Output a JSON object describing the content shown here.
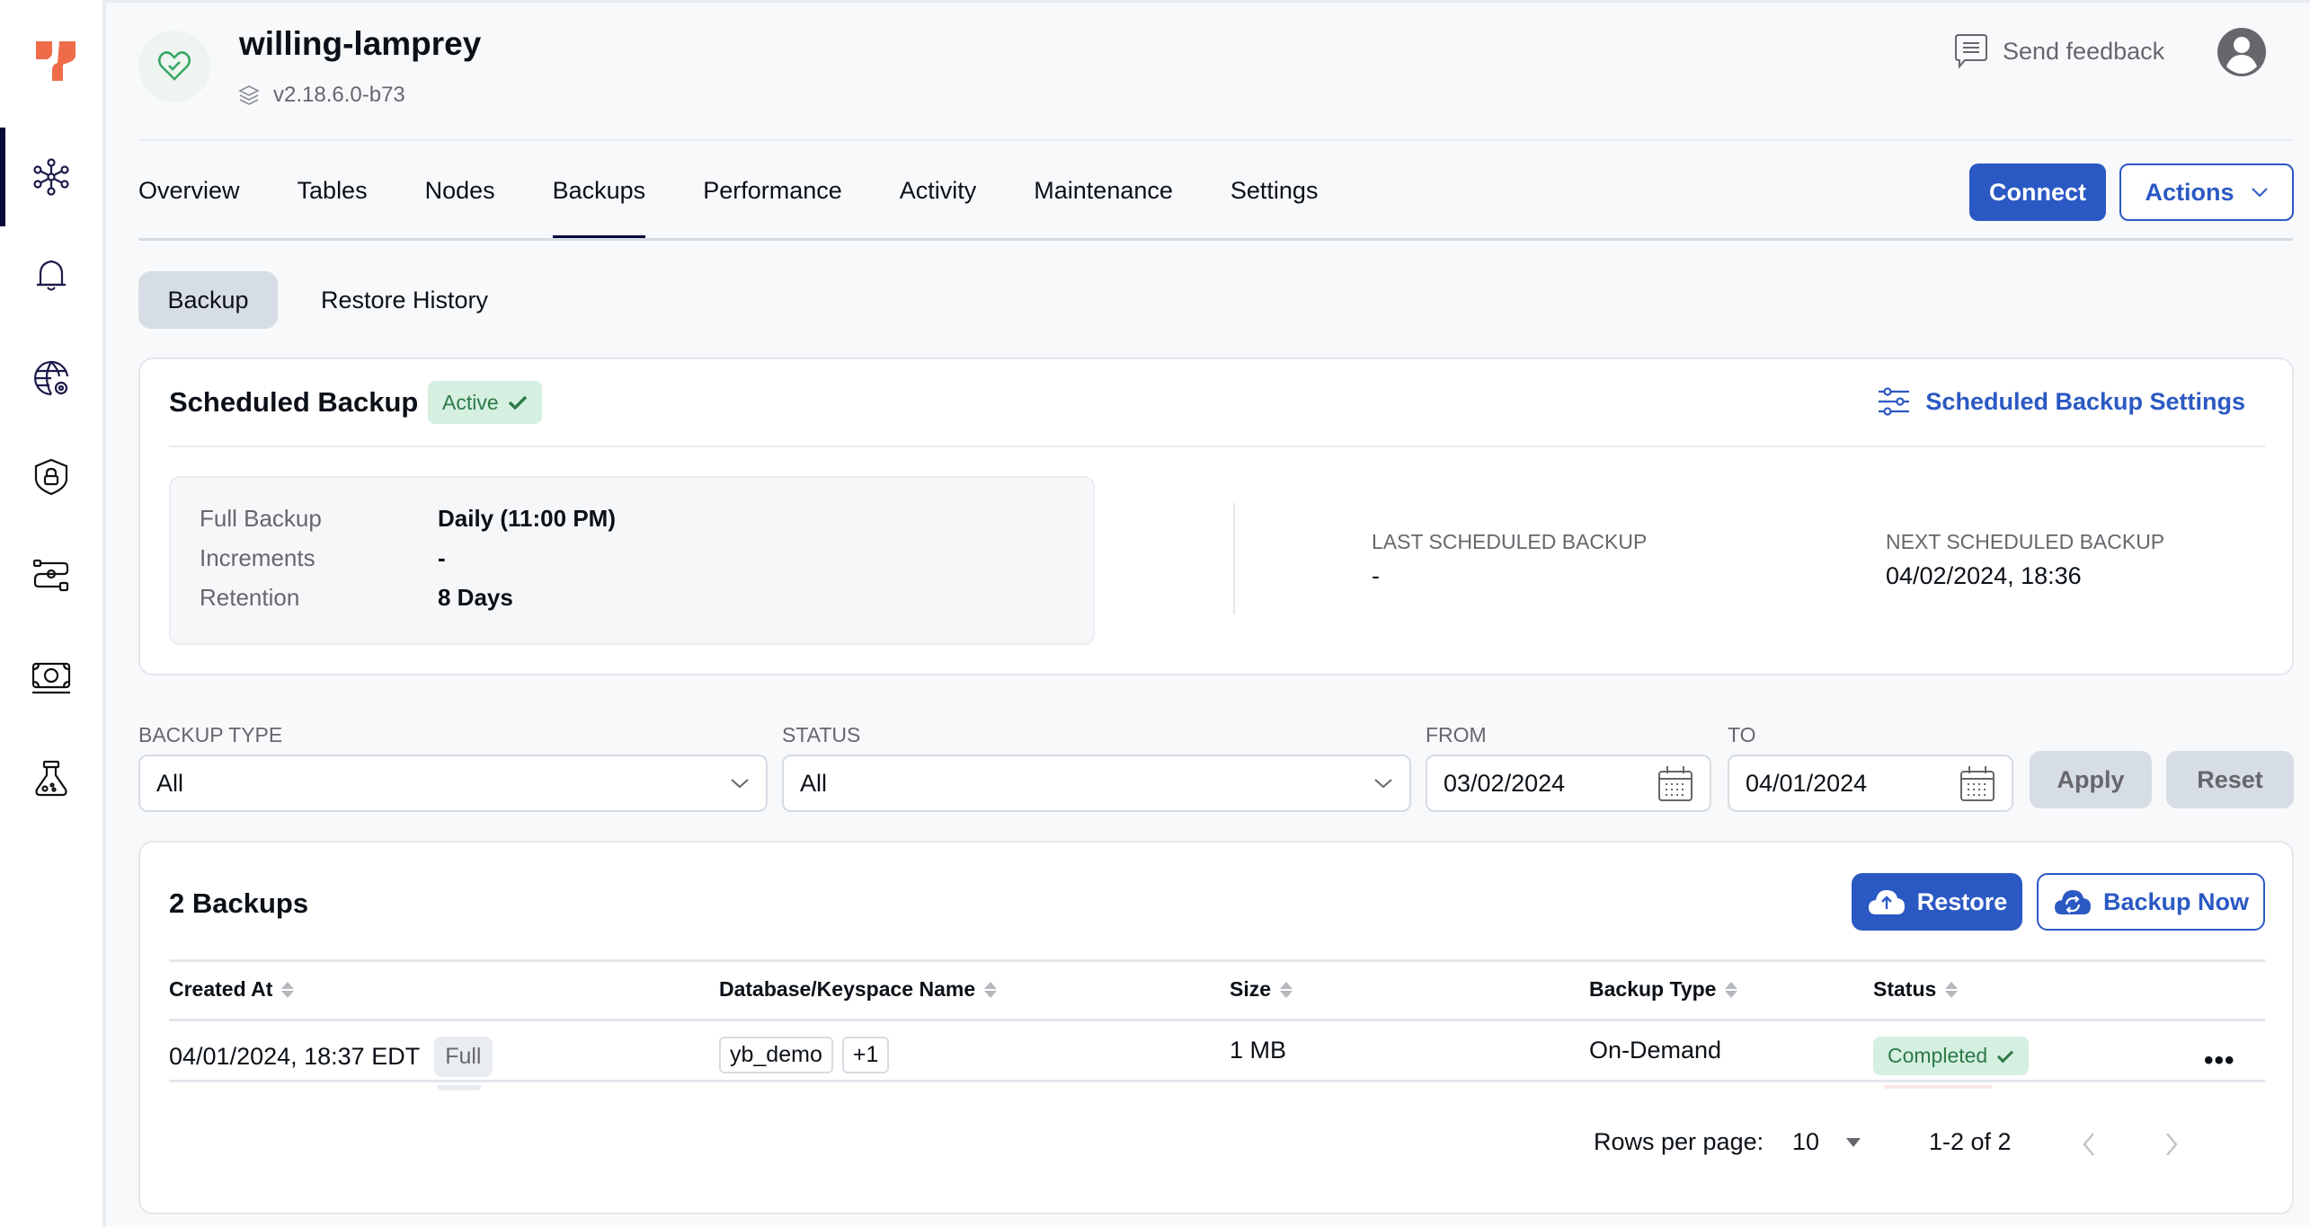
{
  "topbar": {
    "universe_name": "willing-lamprey",
    "version": "v2.18.6.0-b73",
    "feedback_label": "Send feedback"
  },
  "sidebar": {
    "items": [
      {
        "name": "universes",
        "icon": "network-icon",
        "active": true
      },
      {
        "name": "alerts",
        "icon": "bell-icon",
        "active": false
      },
      {
        "name": "config",
        "icon": "globe-gear-icon",
        "active": false
      },
      {
        "name": "security",
        "icon": "shield-lock-icon",
        "active": false
      },
      {
        "name": "workflows",
        "icon": "route-icon",
        "active": false
      },
      {
        "name": "billing",
        "icon": "money-icon",
        "active": false
      },
      {
        "name": "labs",
        "icon": "flask-icon",
        "active": false
      }
    ]
  },
  "tabs": [
    {
      "label": "Overview",
      "active": false
    },
    {
      "label": "Tables",
      "active": false
    },
    {
      "label": "Nodes",
      "active": false
    },
    {
      "label": "Backups",
      "active": true
    },
    {
      "label": "Performance",
      "active": false
    },
    {
      "label": "Activity",
      "active": false
    },
    {
      "label": "Maintenance",
      "active": false
    },
    {
      "label": "Settings",
      "active": false
    }
  ],
  "header_buttons": {
    "connect": "Connect",
    "actions": "Actions"
  },
  "subtabs": [
    {
      "label": "Backup",
      "active": true
    },
    {
      "label": "Restore History",
      "active": false
    }
  ],
  "scheduled_backup": {
    "title": "Scheduled Backup",
    "status_badge": "Active",
    "settings_link": "Scheduled Backup Settings",
    "details": [
      {
        "label": "Full Backup",
        "value": "Daily (11:00 PM)"
      },
      {
        "label": "Increments",
        "value": "-"
      },
      {
        "label": "Retention",
        "value": "8 Days"
      }
    ],
    "last_label": "LAST SCHEDULED BACKUP",
    "last_value": "-",
    "next_label": "NEXT SCHEDULED BACKUP",
    "next_value": "04/02/2024, 18:36"
  },
  "filters": {
    "backup_type_label": "BACKUP TYPE",
    "backup_type_value": "All",
    "status_label": "STATUS",
    "status_value": "All",
    "from_label": "FROM",
    "from_value": "03/02/2024",
    "to_label": "TO",
    "to_value": "04/01/2024",
    "apply": "Apply",
    "reset": "Reset"
  },
  "backups": {
    "title": "2 Backups",
    "restore_button": "Restore",
    "backup_now_button": "Backup Now",
    "columns": [
      "Created At",
      "Database/Keyspace Name",
      "Size",
      "Backup Type",
      "Status"
    ],
    "rows": [
      {
        "created_at": "04/01/2024, 18:37 EDT",
        "kind": "Full",
        "database": "yb_demo",
        "extra_count": "+1",
        "size": "1 MB",
        "backup_type": "On-Demand",
        "status": "Completed"
      }
    ],
    "pagination": {
      "rows_per_page_label": "Rows per page:",
      "rows_per_page": "10",
      "range": "1-2 of 2"
    }
  },
  "colors": {
    "primary": "#2b59c3",
    "nav_active": "#090939",
    "success_bg": "#d5efe1",
    "success_text": "#2d7a47",
    "logo": "#ef6c4a"
  }
}
